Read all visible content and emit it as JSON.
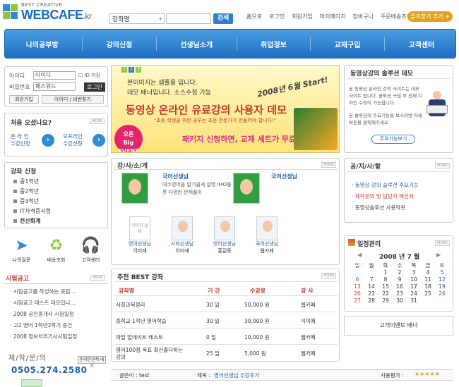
{
  "header": {
    "logo_small": "BEST CREATIVE",
    "logo_main": "WEBCAFE",
    "logo_tld": ".kr",
    "search_select": "강좌명",
    "search_button": "검색",
    "links": [
      "홈으로",
      "로그인",
      "회원가입",
      "마이페이지",
      "장바구니",
      "주문배송조회"
    ],
    "favorites": "즐겨찾기 추가"
  },
  "nav": [
    "나의공부방",
    "강의신청",
    "선생님소개",
    "취업정보",
    "교재구입",
    "고객센터"
  ],
  "login": {
    "id_label": "아이디",
    "id_value": "아이디",
    "save_label": "ID 저장",
    "pw_label": "비밀번호",
    "pw_value": "패스워드",
    "login_button": "로그인",
    "join_button": "회원가입",
    "find_button": "아이디 / 비번찾기"
  },
  "first_visit": {
    "title": "처음 오셨나요?",
    "more": "MORE",
    "online": [
      "온 라 인",
      "수강신청"
    ],
    "offline": [
      "오프라인",
      "수강신청"
    ]
  },
  "courses": {
    "title": "강좌 신청",
    "items": [
      "중1학년",
      "중2학년",
      "중3학년",
      "IT자격증시험",
      "전산회계"
    ]
  },
  "quick_icons": [
    "나의질문",
    "배송조회",
    "고객센터"
  ],
  "exam_notice": {
    "title": "시험공고",
    "more": "MORE",
    "items": [
      "시험공고를 작성하는 곳입...",
      "시험공고 테스트 데모입니...",
      "2008 공인중개사 시험일정",
      "고2 영어 1학년2학기 중간",
      "2008 정보처리기사시험일정"
    ]
  },
  "contact": {
    "title": "제/작/문/의",
    "phone": "0505.274.2580",
    "online_button": "온라인견적 내기"
  },
  "banner": {
    "tabs": [
      "1",
      "2",
      "3"
    ],
    "line1": "본이미지는 샘플용 입니다.",
    "line2": "데모 배너입니다. 소스수정 가능",
    "headline": "동영상 온라인 유료강의 사용자 데모",
    "sub": "\"초등 학생을 위한 공부는 초등 전문가가 만들어야 합니다!\"",
    "event_line": "패키지 신청하면, 교재 세트가 무료!",
    "start_text": "2008년 6월 Start!",
    "badge_top": "오픈",
    "badge_bottom": "Big EVENT"
  },
  "teachers": {
    "title": "강/사/소/개",
    "more": "MORE",
    "featured": [
      {
        "name": "국어선생님",
        "desc": "대수명어을 알기쉽게 설명 IMO를 비롯 다양한 문제풀이"
      },
      {
        "name": "국어선생님",
        "desc": ""
      }
    ],
    "small": [
      {
        "photo_text": "이미지 없음",
        "subject": "영어선생님",
        "name": "이미애"
      },
      {
        "photo_text": "",
        "subject": "사회선생님",
        "name": "이미애"
      },
      {
        "photo_text": "",
        "subject": "영어선생님",
        "name": "홍길동"
      },
      {
        "photo_text": "",
        "subject": "국어선생님",
        "name": "웹카페"
      }
    ]
  },
  "best": {
    "title": "추천 BEST 강좌",
    "more": "MORE",
    "headers": [
      "강좌명",
      "기 간",
      "수강료",
      "강 사"
    ],
    "rows": [
      [
        "사회과목정리",
        "30 일",
        "50,000 원",
        "웹카페"
      ],
      [
        "중학교 1학년 영어학습",
        "30 일",
        "30,000 원",
        "이미애"
      ],
      [
        "파일 업데이트 테스트",
        "0 일",
        "10,000 원",
        "웹카페"
      ],
      [
        "영어100점 목표 최신출다하는 강의",
        "25 일",
        "5,000 원",
        "웹카페"
      ]
    ]
  },
  "bottom_bar": {
    "user_label": "글쓴이 : test",
    "subject_label": "제목 :",
    "subject": "영어선생님 수강후기",
    "rating_label": "사용평가 :",
    "stars": "★★★★★"
  },
  "solution": {
    "title": "동영상강의 솔루션 데모",
    "text1": "본 동영상 온라인 강의 사이트는 데모사이트 입니다. 솔루션 구입 후 전체 디자인 수정이 가능합니다.",
    "text2": "본 솔루션의 주요기능을 보시려면 아래 버튼을 클릭해주세요",
    "button": "주요기능보기"
  },
  "notices": {
    "title": "공/지/사/항",
    "more": "MORE",
    "items": [
      {
        "text": "동영상 강의 솔루션 주요기능",
        "color": "#1f5ea8"
      },
      {
        "text": "제작문의 및 담당자 메신저",
        "color": "#c0392b"
      },
      {
        "text": "동영상솔루션 사용약관",
        "color": "#444444"
      }
    ]
  },
  "calendar": {
    "title": "일정관리",
    "more": "MORE",
    "heading": "2008 년 7 월",
    "weekdays": [
      "일",
      "월",
      "화",
      "수",
      "목",
      "금",
      "토"
    ],
    "weeks": [
      [
        "",
        "",
        "1",
        "2",
        "3",
        "4",
        "5"
      ],
      [
        "6",
        "7",
        "8",
        "9",
        "10",
        "11",
        "12"
      ],
      [
        "13",
        "14",
        "15",
        "16",
        "17",
        "18",
        "19"
      ],
      [
        "20",
        "21",
        "22",
        "23",
        "24",
        "25",
        "26"
      ],
      [
        "27",
        "28",
        "29",
        "30",
        "31",
        "",
        ""
      ]
    ]
  },
  "event_banner": "고객이벤트 배너",
  "colors": {
    "brand": "#1f6fc4",
    "accent": "#c0392b",
    "highlight": "#e2a21d"
  }
}
